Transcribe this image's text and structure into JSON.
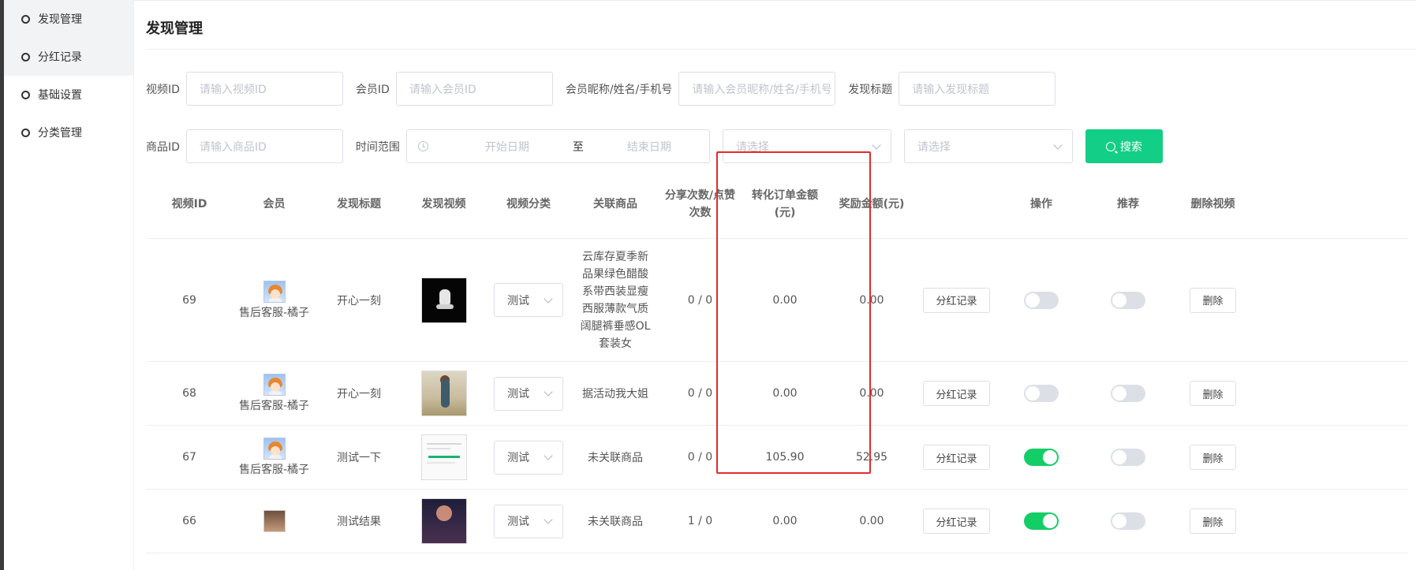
{
  "sidebar": {
    "items": [
      {
        "label": "发现管理"
      },
      {
        "label": "分红记录"
      },
      {
        "label": "基础设置"
      },
      {
        "label": "分类管理"
      }
    ]
  },
  "page": {
    "title": "发现管理"
  },
  "filters": {
    "video_id": {
      "label": "视频ID",
      "placeholder": "请输入视频ID"
    },
    "member_id": {
      "label": "会员ID",
      "placeholder": "请输入会员ID"
    },
    "member_info": {
      "label": "会员昵称/姓名/手机号",
      "placeholder": "请输入会员昵称/姓名/手机号"
    },
    "title": {
      "label": "发现标题",
      "placeholder": "请输入发现标题"
    },
    "goods_id": {
      "label": "商品ID",
      "placeholder": "请输入商品ID"
    },
    "time_range": {
      "label": "时间范围",
      "start": "开始日期",
      "sep": "至",
      "end": "结束日期"
    },
    "select1": {
      "placeholder": "请选择"
    },
    "select2": {
      "placeholder": "请选择"
    },
    "search_label": "搜索"
  },
  "table": {
    "headers": {
      "video_id": "视频ID",
      "member": "会员",
      "title": "发现标题",
      "video": "发现视频",
      "category": "视频分类",
      "goods": "关联商品",
      "share_like_1": "分享次数/点赞",
      "share_like_2": "次数",
      "order_amount_1": "转化订单金额",
      "order_amount_2": "(元)",
      "reward_amount": "奖励金额(元)",
      "operation": "操作",
      "recommend": "推荐",
      "delete_video": "删除视频"
    },
    "rows": [
      {
        "id": "69",
        "member": "售后客服-橘子",
        "title": "开心一刻",
        "category": "测试",
        "goods": "云库存夏季新品果绿色醋酸系带西装显瘦西服薄款气质阔腿裤垂感OL套装女",
        "share_like": "0 / 0",
        "order_amount": "0.00",
        "reward_amount": "0.00",
        "dividend_label": "分红记录",
        "operation_on": false,
        "recommend_on": false,
        "delete_label": "删除"
      },
      {
        "id": "68",
        "member": "售后客服-橘子",
        "title": "开心一刻",
        "category": "测试",
        "goods": "据活动我大姐",
        "share_like": "0 / 0",
        "order_amount": "0.00",
        "reward_amount": "0.00",
        "dividend_label": "分红记录",
        "operation_on": false,
        "recommend_on": false,
        "delete_label": "删除"
      },
      {
        "id": "67",
        "member": "售后客服-橘子",
        "title": "测试一下",
        "category": "测试",
        "goods": "未关联商品",
        "share_like": "0 / 0",
        "order_amount": "105.90",
        "reward_amount": "52.95",
        "dividend_label": "分红记录",
        "operation_on": true,
        "recommend_on": false,
        "delete_label": "删除"
      },
      {
        "id": "66",
        "member": "",
        "title": "测试结果",
        "category": "测试",
        "goods": "未关联商品",
        "share_like": "1 / 0",
        "order_amount": "0.00",
        "reward_amount": "0.00",
        "dividend_label": "分红记录",
        "operation_on": true,
        "recommend_on": false,
        "delete_label": "删除"
      }
    ]
  },
  "colors": {
    "accent": "#13ce86",
    "highlight": "#e42b2b",
    "toggle_on": "#13ce66"
  }
}
